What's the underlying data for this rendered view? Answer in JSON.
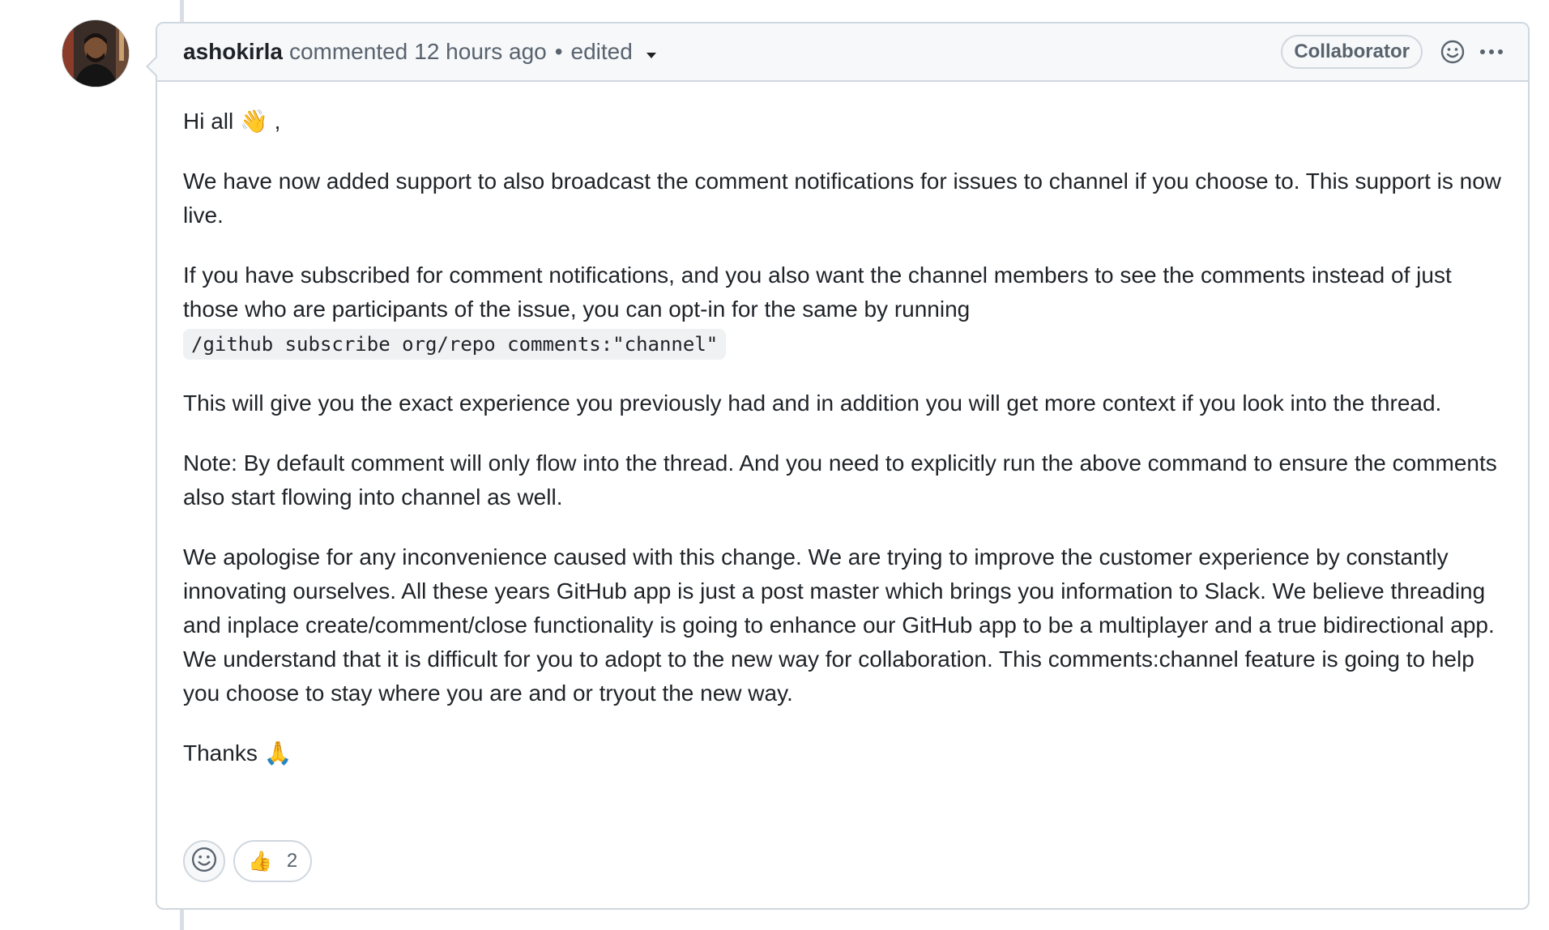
{
  "comment": {
    "author": "ashokirla",
    "action": "commented",
    "timestamp": "12 hours ago",
    "separator": "•",
    "edited_label": "edited",
    "author_role_badge": "Collaborator",
    "icons": {
      "reaction_picker": "smiley-icon",
      "more_options": "kebab-horizontal-icon",
      "edited_menu": "triangle-down-icon"
    }
  },
  "body": {
    "greeting_text": "Hi all",
    "greeting_emoji": "👋",
    "greeting_suffix": ",",
    "p1": "We have now added support to also broadcast the comment notifications for issues to channel if you choose to. This support is now live.",
    "p2": "If you have subscribed for comment notifications, and you also want the channel members to see the comments instead of just those who are participants of the issue, you can opt-in for the same by running",
    "code": "/github subscribe org/repo comments:\"channel\"",
    "p3": "This will give you the exact experience you previously had and in addition you will get more context if you look into the thread.",
    "p4": "Note: By default comment will only flow into the thread. And you need to explicitly run the above command to ensure the comments also start flowing into channel as well.",
    "p5": "We apologise for any inconvenience caused with this change. We are trying to improve the customer experience by constantly innovating ourselves. All these years GitHub app is just a post master which brings you information to Slack. We believe threading and inplace create/comment/close functionality is going to enhance our GitHub app to be a multiplayer and a true bidirectional app. We understand that it is difficult for you to adopt to the new way for collaboration. This comments:channel feature is going to help you choose to stay where you are and or tryout the new way.",
    "thanks_text": "Thanks",
    "thanks_emoji": "🙏"
  },
  "reactions": {
    "add_icon": "smiley-icon",
    "items": [
      {
        "emoji": "👍",
        "count": "2"
      }
    ]
  },
  "colors": {
    "border": "#d0d7de",
    "header_bg": "#f6f8fa",
    "muted_text": "#59636e",
    "text": "#1f2328",
    "code_bg": "#eff1f3"
  }
}
